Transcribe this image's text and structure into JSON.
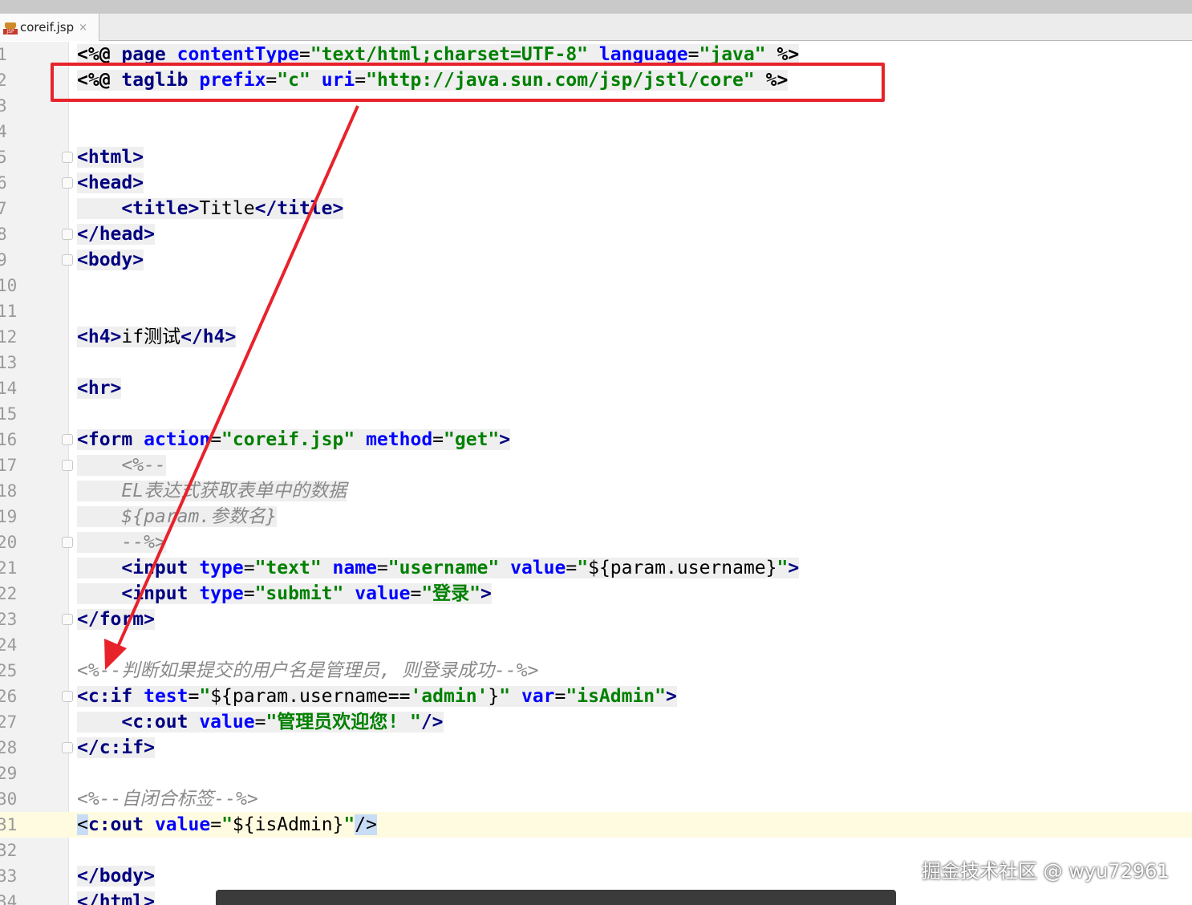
{
  "tab": {
    "filename": "coreif.jsp",
    "icon": "jsp-file-icon",
    "close": "×",
    "badge": "JSP"
  },
  "lines": [
    {
      "n": "1",
      "tokens": [
        [
          "dir",
          "<%@ "
        ],
        [
          "tag",
          "page "
        ],
        [
          "attr",
          "contentType"
        ],
        [
          "plain",
          "="
        ],
        [
          "str",
          "\"text/html;charset=UTF-8\""
        ],
        [
          "plain",
          " "
        ],
        [
          "attr",
          "language"
        ],
        [
          "plain",
          "="
        ],
        [
          "str",
          "\"java\""
        ],
        [
          "plain",
          " "
        ],
        [
          "dir",
          "%>"
        ]
      ]
    },
    {
      "n": "2",
      "tokens": [
        [
          "dir",
          "<%@ "
        ],
        [
          "tag",
          "taglib "
        ],
        [
          "attr",
          "prefix"
        ],
        [
          "plain",
          "="
        ],
        [
          "str",
          "\"c\""
        ],
        [
          "plain",
          " "
        ],
        [
          "attr",
          "uri"
        ],
        [
          "plain",
          "="
        ],
        [
          "str",
          "\"http://java.sun.com/jsp/jstl/core\""
        ],
        [
          "plain",
          " "
        ],
        [
          "dir",
          "%>"
        ]
      ]
    },
    {
      "n": "3",
      "tokens": []
    },
    {
      "n": "4",
      "tokens": []
    },
    {
      "n": "5",
      "fold": true,
      "tokens": [
        [
          "tag",
          "<html>"
        ]
      ]
    },
    {
      "n": "6",
      "fold": true,
      "tokens": [
        [
          "tag",
          "<head>"
        ]
      ]
    },
    {
      "n": "7",
      "tokens": [
        [
          "plain",
          "    "
        ],
        [
          "tag",
          "<title>"
        ],
        [
          "plain",
          "Title"
        ],
        [
          "tag",
          "</title>"
        ]
      ]
    },
    {
      "n": "8",
      "fold": true,
      "tokens": [
        [
          "tag",
          "</head>"
        ]
      ]
    },
    {
      "n": "9",
      "fold": true,
      "tokens": [
        [
          "tag",
          "<body>"
        ]
      ]
    },
    {
      "n": "10",
      "tokens": []
    },
    {
      "n": "11",
      "tokens": []
    },
    {
      "n": "12",
      "tokens": [
        [
          "tag",
          "<h4>"
        ],
        [
          "plain",
          "if测试"
        ],
        [
          "tag",
          "</h4>"
        ]
      ]
    },
    {
      "n": "13",
      "tokens": []
    },
    {
      "n": "14",
      "tokens": [
        [
          "tag",
          "<hr>"
        ]
      ]
    },
    {
      "n": "15",
      "tokens": []
    },
    {
      "n": "16",
      "fold": true,
      "tokens": [
        [
          "tag",
          "<form "
        ],
        [
          "attr",
          "action"
        ],
        [
          "plain",
          "="
        ],
        [
          "str",
          "\"coreif.jsp\""
        ],
        [
          "plain",
          " "
        ],
        [
          "attr",
          "method"
        ],
        [
          "plain",
          "="
        ],
        [
          "str",
          "\"get\""
        ],
        [
          "tag",
          ">"
        ]
      ]
    },
    {
      "n": "17",
      "fold": true,
      "tokens": [
        [
          "plain",
          "    "
        ],
        [
          "cmt",
          "<%--"
        ]
      ]
    },
    {
      "n": "18",
      "tokens": [
        [
          "plain",
          "    "
        ],
        [
          "cmt",
          "EL表达式获取表单中的数据"
        ]
      ]
    },
    {
      "n": "19",
      "tokens": [
        [
          "plain",
          "    "
        ],
        [
          "cmt",
          "${param.参数名}"
        ]
      ]
    },
    {
      "n": "20",
      "fold": true,
      "tokens": [
        [
          "plain",
          "    "
        ],
        [
          "cmt",
          "--%>"
        ]
      ]
    },
    {
      "n": "21",
      "tokens": [
        [
          "plain",
          "    "
        ],
        [
          "tag",
          "<input "
        ],
        [
          "attr",
          "type"
        ],
        [
          "plain",
          "="
        ],
        [
          "str",
          "\"text\""
        ],
        [
          "plain",
          " "
        ],
        [
          "attr",
          "name"
        ],
        [
          "plain",
          "="
        ],
        [
          "str",
          "\"username\""
        ],
        [
          "plain",
          " "
        ],
        [
          "attr",
          "value"
        ],
        [
          "plain",
          "="
        ],
        [
          "str",
          "\""
        ],
        [
          "plain",
          "${param.username}"
        ],
        [
          "str",
          "\""
        ],
        [
          "tag",
          ">"
        ]
      ]
    },
    {
      "n": "22",
      "tokens": [
        [
          "plain",
          "    "
        ],
        [
          "tag",
          "<input "
        ],
        [
          "attr",
          "type"
        ],
        [
          "plain",
          "="
        ],
        [
          "str",
          "\"submit\""
        ],
        [
          "plain",
          " "
        ],
        [
          "attr",
          "value"
        ],
        [
          "plain",
          "="
        ],
        [
          "str",
          "\"登录\""
        ],
        [
          "tag",
          ">"
        ]
      ]
    },
    {
      "n": "23",
      "fold": true,
      "tokens": [
        [
          "tag",
          "</form>"
        ]
      ]
    },
    {
      "n": "24",
      "tokens": []
    },
    {
      "n": "25",
      "tokens": [
        [
          "cmt",
          "<%--判断如果提交的用户名是管理员, 则登录成功--%>"
        ]
      ]
    },
    {
      "n": "26",
      "fold": true,
      "tokens": [
        [
          "tag",
          "<c:if "
        ],
        [
          "attr",
          "test"
        ],
        [
          "plain",
          "="
        ],
        [
          "str",
          "\""
        ],
        [
          "plain",
          "${param.username=="
        ],
        [
          "str",
          "'admin'"
        ],
        [
          "plain",
          "}"
        ],
        [
          "str",
          "\""
        ],
        [
          "plain",
          " "
        ],
        [
          "attr",
          "var"
        ],
        [
          "plain",
          "="
        ],
        [
          "str",
          "\"isAdmin\""
        ],
        [
          "tag",
          ">"
        ]
      ]
    },
    {
      "n": "27",
      "tokens": [
        [
          "plain",
          "    "
        ],
        [
          "tag",
          "<c:out "
        ],
        [
          "attr",
          "value"
        ],
        [
          "plain",
          "="
        ],
        [
          "str",
          "\"管理员欢迎您! \""
        ],
        [
          "tag",
          "/>"
        ]
      ]
    },
    {
      "n": "28",
      "fold": true,
      "tokens": [
        [
          "tag",
          "</c:if>"
        ]
      ]
    },
    {
      "n": "29",
      "tokens": []
    },
    {
      "n": "30",
      "tokens": [
        [
          "cmt",
          "<%--自闭合标签--%>"
        ]
      ]
    },
    {
      "n": "31",
      "current": true,
      "tokens": [
        [
          "hl",
          "<"
        ],
        [
          "tag",
          "c:out "
        ],
        [
          "attr",
          "value"
        ],
        [
          "plain",
          "="
        ],
        [
          "str",
          "\""
        ],
        [
          "plain",
          "${isAdmin}"
        ],
        [
          "str",
          "\""
        ],
        [
          "hl",
          "/>"
        ]
      ]
    },
    {
      "n": "32",
      "tokens": []
    },
    {
      "n": "33",
      "tokens": [
        [
          "tag",
          "</body>"
        ]
      ]
    },
    {
      "n": "34",
      "tokens": [
        [
          "tag",
          "</html>"
        ]
      ]
    }
  ],
  "watermark": "掘金技术社区 @ wyu72961",
  "colors": {
    "annotation": "#e8222b",
    "tag": "#000080",
    "attr": "#0000ff",
    "string": "#008000",
    "comment": "#8a8a8a"
  }
}
